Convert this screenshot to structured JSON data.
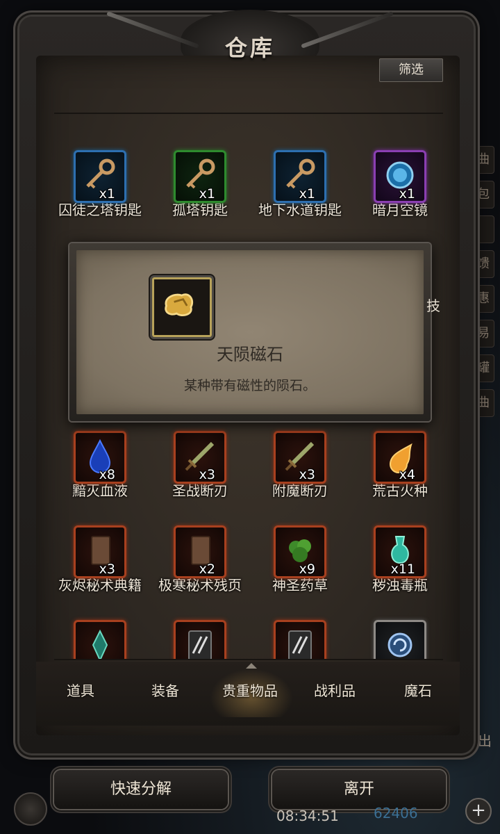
{
  "header": {
    "title": "仓库",
    "filter_label": "筛选"
  },
  "grid": {
    "rows": [
      {
        "items": [
          {
            "name": "囚徒之塔钥匙",
            "count": "x1",
            "rarity": "blue",
            "icon": "key-icon"
          },
          {
            "name": "孤塔钥匙",
            "count": "x1",
            "rarity": "green",
            "icon": "key-icon"
          },
          {
            "name": "地下水道钥匙",
            "count": "x1",
            "rarity": "blue",
            "icon": "key-icon"
          },
          {
            "name": "暗月空镜",
            "count": "x1",
            "rarity": "purple",
            "icon": "mirror-icon"
          }
        ]
      },
      {
        "items": [
          {
            "name": "黯灭血液",
            "count": "x8",
            "rarity": "red",
            "icon": "blood-drop-icon"
          },
          {
            "name": "圣战断刃",
            "count": "x3",
            "rarity": "red",
            "icon": "broken-blade-icon"
          },
          {
            "name": "附魔断刃",
            "count": "x3",
            "rarity": "red",
            "icon": "broken-blade-icon"
          },
          {
            "name": "荒古火种",
            "count": "x4",
            "rarity": "red",
            "icon": "fire-seed-icon"
          }
        ]
      },
      {
        "items": [
          {
            "name": "灰烬秘术典籍",
            "count": "x3",
            "rarity": "red",
            "icon": "book-icon"
          },
          {
            "name": "极寒秘术残页",
            "count": "x2",
            "rarity": "red",
            "icon": "book-icon"
          },
          {
            "name": "神圣药草",
            "count": "x9",
            "rarity": "red",
            "icon": "herb-icon"
          },
          {
            "name": "秽浊毒瓶",
            "count": "x11",
            "rarity": "red",
            "icon": "poison-vial-icon"
          }
        ]
      },
      {
        "items": [
          {
            "name": "",
            "count": "",
            "rarity": "red",
            "icon": "crystal-icon"
          },
          {
            "name": "",
            "count": "",
            "rarity": "red",
            "icon": "scroll-icon"
          },
          {
            "name": "",
            "count": "",
            "rarity": "red",
            "icon": "scroll-icon"
          },
          {
            "name": "",
            "count": "",
            "rarity": "grey",
            "icon": "frost-orb-icon"
          }
        ]
      }
    ]
  },
  "tooltip": {
    "name": "天陨磁石",
    "description": "某种带有磁性的陨石。",
    "icon": "meteorite-icon",
    "edge_text": "技"
  },
  "tabs": [
    {
      "label": "道具"
    },
    {
      "label": "装备"
    },
    {
      "label": "贵重物品",
      "active": true
    },
    {
      "label": "战利品"
    },
    {
      "label": "魔石"
    }
  ],
  "buttons": {
    "decompose": "快速分解",
    "leave": "离开"
  },
  "hud": {
    "clock": "08:34:51",
    "coins": "62406",
    "side_text": "出",
    "side_tabs": [
      "曲",
      "包",
      "",
      "馈",
      "惠",
      "易",
      "罐",
      "曲"
    ]
  }
}
